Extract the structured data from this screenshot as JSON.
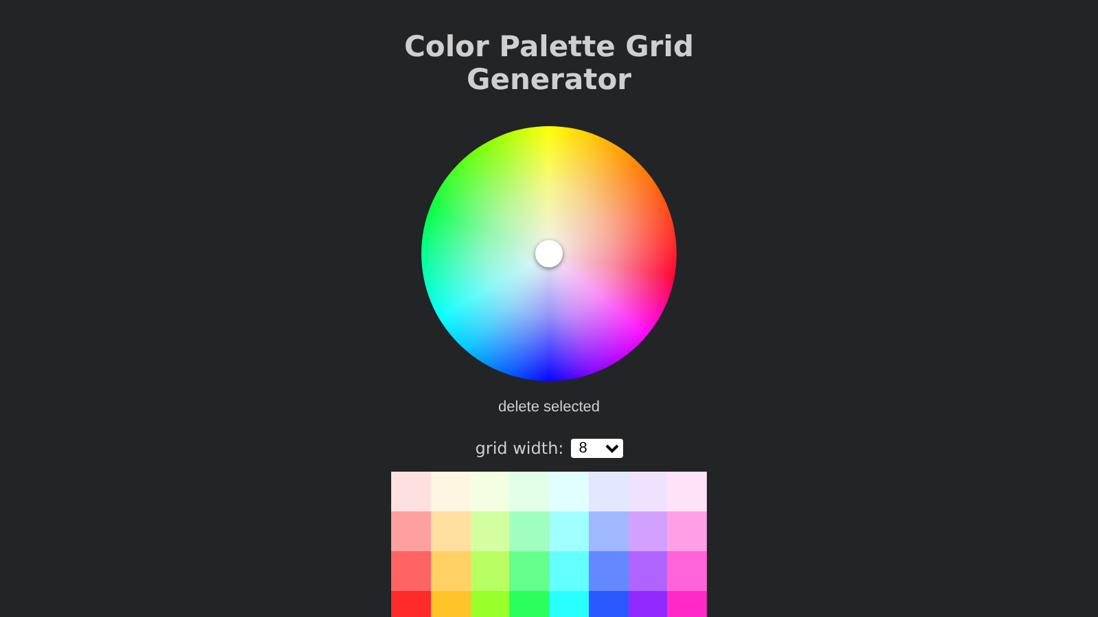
{
  "title": "Color Palette Grid Generator",
  "delete_button": "delete selected",
  "grid_width": {
    "label": "grid width:",
    "value": "8"
  },
  "grid": [
    {
      "cells": [
        {
          "color": "#ffe0e0"
        },
        {
          "color": "#fff6e2"
        },
        {
          "color": "#f4ffe2"
        },
        {
          "color": "#e2ffe8"
        },
        {
          "color": "#e2ffff"
        },
        {
          "color": "#e2e8ff"
        },
        {
          "color": "#f0e2ff"
        },
        {
          "color": "#ffe2f8"
        }
      ]
    },
    {
      "cells": [
        {
          "color": "#ffa0a0"
        },
        {
          "color": "#ffe0a0"
        },
        {
          "color": "#d4ffa0"
        },
        {
          "color": "#a0ffc0"
        },
        {
          "color": "#a0ffff"
        },
        {
          "color": "#a0b8ff"
        },
        {
          "color": "#d2a0ff"
        },
        {
          "color": "#ffa0e6"
        }
      ]
    },
    {
      "cells": [
        {
          "color": "#ff6464"
        },
        {
          "color": "#ffd064"
        },
        {
          "color": "#b8ff64"
        },
        {
          "color": "#64ff8c"
        },
        {
          "color": "#64ffff"
        },
        {
          "color": "#6488ff"
        },
        {
          "color": "#b064ff"
        },
        {
          "color": "#ff64d8"
        }
      ]
    },
    {
      "cells": [
        {
          "color": "#ff2a2a"
        },
        {
          "color": "#ffc42a"
        },
        {
          "color": "#98ff2a"
        },
        {
          "color": "#2aff5e"
        },
        {
          "color": "#2affff"
        },
        {
          "color": "#2a5aff"
        },
        {
          "color": "#922aff"
        },
        {
          "color": "#ff2ac8"
        }
      ]
    }
  ]
}
